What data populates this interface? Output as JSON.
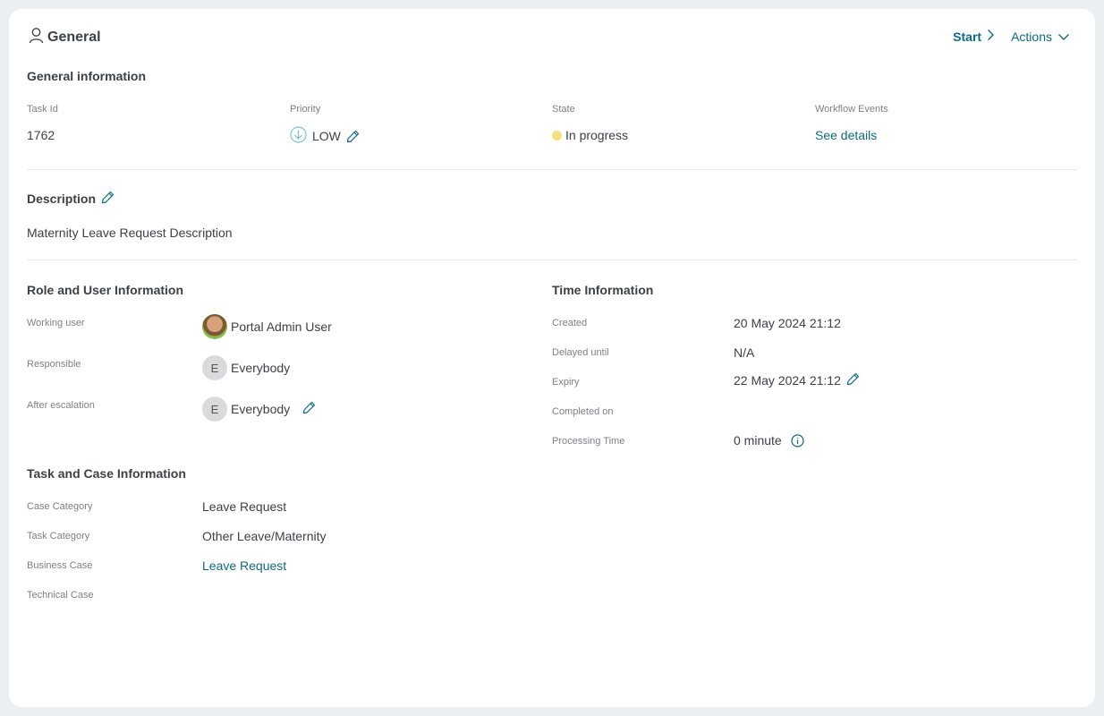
{
  "header": {
    "title": "General",
    "start_label": "Start",
    "actions_label": "Actions"
  },
  "general_info": {
    "title": "General information",
    "task_id": {
      "label": "Task Id",
      "value": "1762"
    },
    "priority": {
      "label": "Priority",
      "value": "LOW"
    },
    "state": {
      "label": "State",
      "value": "In progress",
      "color": "#f5e07a"
    },
    "workflow": {
      "label": "Workflow Events",
      "value": "See details"
    }
  },
  "description": {
    "title": "Description",
    "text": "Maternity Leave Request Description"
  },
  "role_info": {
    "title": "Role and User Information",
    "working_user": {
      "label": "Working user",
      "value": "Portal Admin User"
    },
    "responsible": {
      "label": "Responsible",
      "avatar": "E",
      "value": "Everybody"
    },
    "after_escalation": {
      "label": "After escalation",
      "avatar": "E",
      "value": "Everybody"
    }
  },
  "time_info": {
    "title": "Time Information",
    "created": {
      "label": "Created",
      "value": "20 May 2024 21:12"
    },
    "delayed": {
      "label": "Delayed until",
      "value": "N/A"
    },
    "expiry": {
      "label": "Expiry",
      "value": "22 May 2024 21:12"
    },
    "completed": {
      "label": "Completed on",
      "value": ""
    },
    "processing": {
      "label": "Processing Time",
      "value": "0 minute"
    }
  },
  "task_case_info": {
    "title": "Task and Case Information",
    "case_category": {
      "label": "Case Category",
      "value": "Leave Request"
    },
    "task_category": {
      "label": "Task Category",
      "value": "Other Leave/Maternity"
    },
    "business_case": {
      "label": "Business Case",
      "value": "Leave Request"
    },
    "technical_case": {
      "label": "Technical Case",
      "value": ""
    }
  },
  "colors": {
    "accent": "#0b6b87",
    "text": "#3a4148",
    "muted": "#7a8188",
    "background": "#eceff1"
  }
}
